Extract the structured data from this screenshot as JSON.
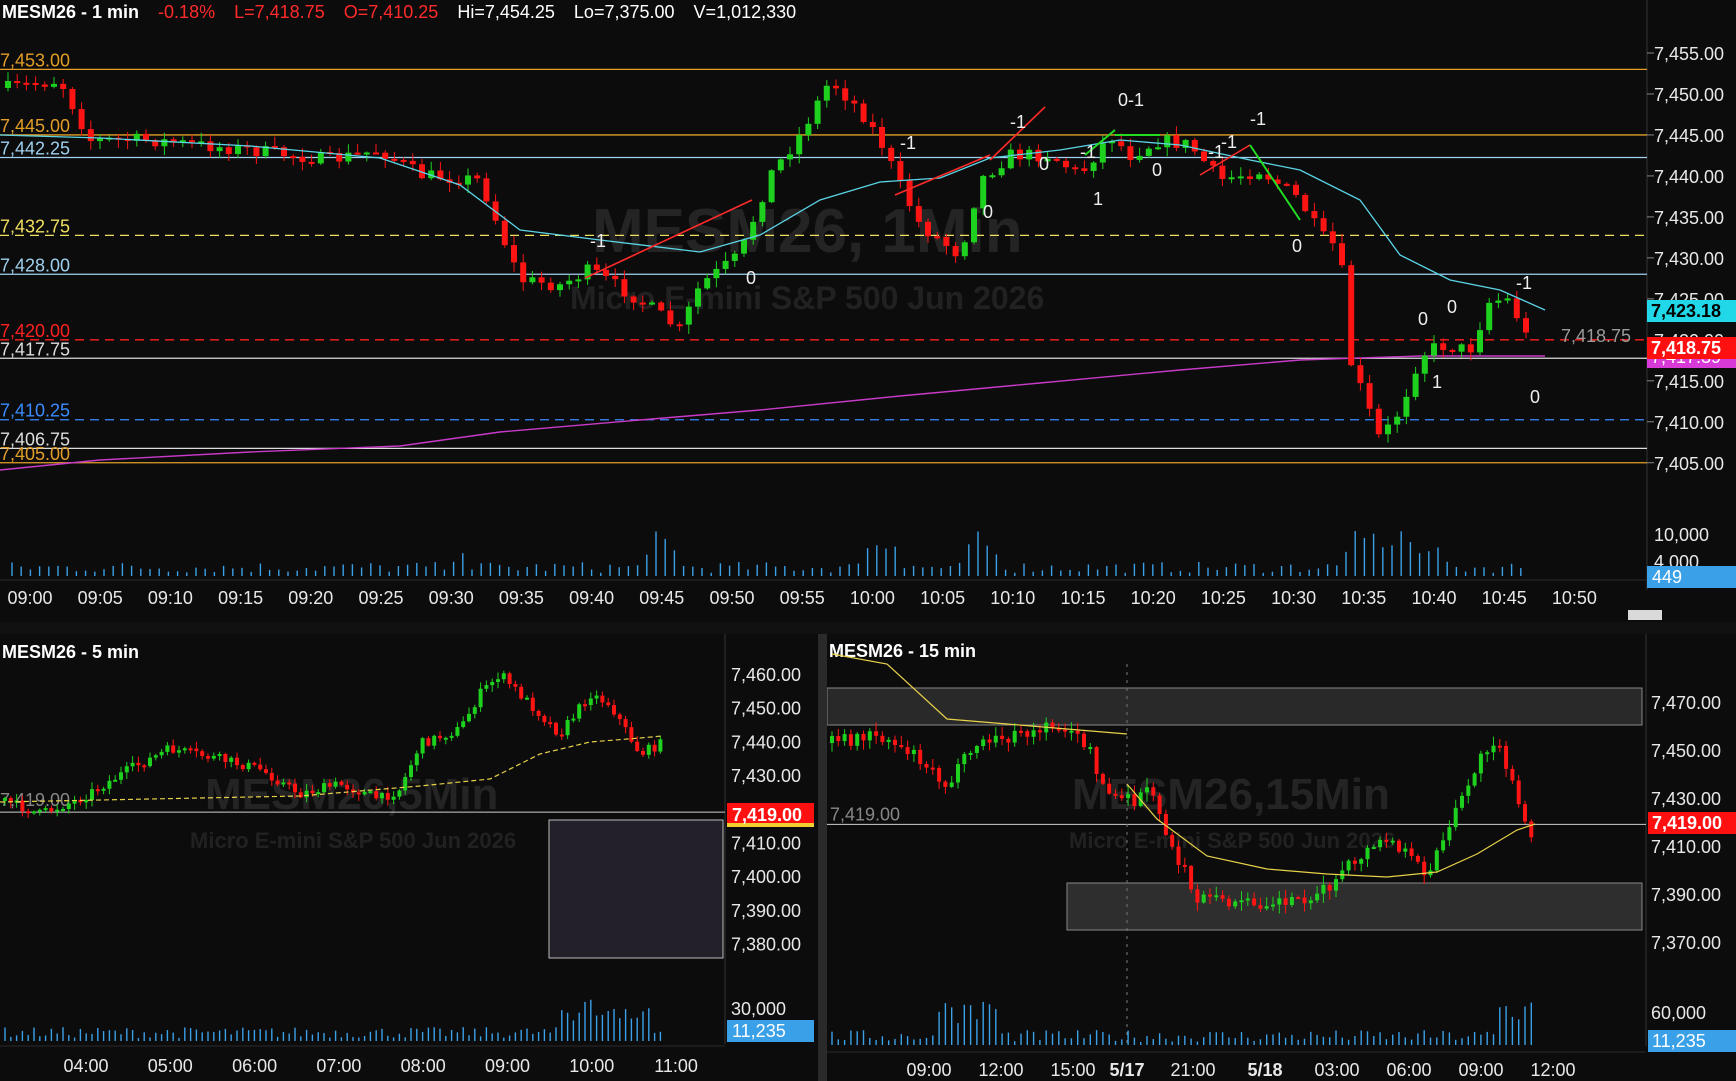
{
  "colors": {
    "up": "#1fd11f",
    "down": "#ff1414",
    "cyan": "#5bd5e6",
    "magenta": "#c83ac8",
    "orange": "#e39e28",
    "volume": "#3aa0e8",
    "trend_up": "#ff2a2a",
    "trend_dn": "#22dd22"
  },
  "main": {
    "header": {
      "symbol": "MESM26 - 1 min",
      "change": "-0.18%",
      "last": "L=7,418.75",
      "open": "O=7,410.25",
      "high": "Hi=7,454.25",
      "low": "Lo=7,375.00",
      "volume": "V=1,012,330"
    },
    "watermark": {
      "title": "MESM26, 1Min",
      "subtitle": "Micro E-mini S&P 500 Jun 2026"
    },
    "y_ticks": [
      "7,455.00",
      "7,450.00",
      "7,445.00",
      "7,440.00",
      "7,435.00",
      "7,430.00",
      "7,425.00",
      "7,420.00",
      "7,415.00",
      "7,410.00",
      "7,405.00"
    ],
    "x_ticks": [
      "09:00",
      "09:05",
      "09:10",
      "09:15",
      "09:20",
      "09:25",
      "09:30",
      "09:35",
      "09:40",
      "09:45",
      "09:50",
      "09:55",
      "10:00",
      "10:05",
      "10:10",
      "10:15",
      "10:20",
      "10:25",
      "10:30",
      "10:35",
      "10:40",
      "10:45",
      "10:50"
    ],
    "levels": [
      {
        "label": "7,453.00",
        "value": 7453.0,
        "color": "#e39e28",
        "style": "solid"
      },
      {
        "label": "7,445.00",
        "value": 7445.0,
        "color": "#e39e28",
        "style": "solid"
      },
      {
        "label": "7,442.25",
        "value": 7442.25,
        "color": "#9fd0ef",
        "style": "solid"
      },
      {
        "label": "7,432.75",
        "value": 7432.75,
        "color": "#f0e060",
        "style": "dashed"
      },
      {
        "label": "7,428.00",
        "value": 7428.0,
        "color": "#9fd0ef",
        "style": "solid"
      },
      {
        "label": "7,420.00",
        "value": 7420.0,
        "color": "#ff2020",
        "style": "dashed"
      },
      {
        "label": "7,417.75",
        "value": 7417.75,
        "color": "#dddddd",
        "style": "solid"
      },
      {
        "label": "7,410.25",
        "value": 7410.25,
        "color": "#3a8cff",
        "style": "dashed"
      },
      {
        "label": "7,406.75",
        "value": 7406.75,
        "color": "#dddddd",
        "style": "solid"
      },
      {
        "label": "7,405.00",
        "value": 7405.0,
        "color": "#e39e28",
        "style": "solid"
      }
    ],
    "badges": {
      "cyan": "7,423.18",
      "last": "7,418.75",
      "magenta": "7,417.39",
      "last_grey": "7,418.75",
      "vol_ticks": [
        "10,000",
        "4,000"
      ],
      "vol_current": "449"
    },
    "swing_labels": [
      {
        "t": "-1",
        "x": 590,
        "y": 247
      },
      {
        "t": "0",
        "x": 746,
        "y": 284
      },
      {
        "t": "-1",
        "x": 900,
        "y": 149
      },
      {
        "t": "0",
        "x": 983,
        "y": 218
      },
      {
        "t": "-1",
        "x": 1010,
        "y": 128
      },
      {
        "t": "0",
        "x": 1039,
        "y": 170
      },
      {
        "t": "-1",
        "x": 1080,
        "y": 158
      },
      {
        "t": "1",
        "x": 1093,
        "y": 205
      },
      {
        "t": "0-1",
        "x": 1118,
        "y": 106
      },
      {
        "t": "0",
        "x": 1152,
        "y": 176
      },
      {
        "t": "-1",
        "x": 1208,
        "y": 158
      },
      {
        "t": "-1",
        "x": 1221,
        "y": 148
      },
      {
        "t": "-1",
        "x": 1250,
        "y": 125
      },
      {
        "t": "0",
        "x": 1292,
        "y": 252
      },
      {
        "t": "0",
        "x": 1418,
        "y": 325
      },
      {
        "t": "0",
        "x": 1447,
        "y": 313
      },
      {
        "t": "1",
        "x": 1432,
        "y": 388
      },
      {
        "t": "-1",
        "x": 1516,
        "y": 289
      },
      {
        "t": "0",
        "x": 1530,
        "y": 403
      }
    ]
  },
  "bl": {
    "header": {
      "symbol": "MESM26 - 5 min"
    },
    "watermark": {
      "title": "MESM26,5Min",
      "subtitle": "Micro E-mini S&P 500 Jun 2026"
    },
    "y_ticks": [
      "7,460.00",
      "7,450.00",
      "7,440.00",
      "7,430.00",
      "7,420.00",
      "7,410.00",
      "7,400.00",
      "7,390.00",
      "7,380.00"
    ],
    "x_ticks": [
      "04:00",
      "05:00",
      "06:00",
      "07:00",
      "08:00",
      "09:00",
      "10:00",
      "11:00"
    ],
    "level": "7,419.00",
    "badge": "7,419.00",
    "vol_tick": "30,000",
    "vol_current": "11,235"
  },
  "br": {
    "header": {
      "symbol": "MESM26 - 15 min"
    },
    "watermark": {
      "title": "MESM26,15Min",
      "subtitle": "Micro E-mini S&P 500 Jun 2026"
    },
    "y_ticks": [
      "7,470.00",
      "7,450.00",
      "7,430.00",
      "7,410.00",
      "7,390.00",
      "7,370.00"
    ],
    "x_ticks": [
      "09:00",
      "12:00",
      "15:00",
      "5/17",
      "21:00",
      "5/18",
      "03:00",
      "06:00",
      "09:00",
      "12:00"
    ],
    "level": "7,419.00",
    "badge": "7,419.00",
    "vol_tick": "60,000",
    "vol_current": "11,235"
  }
}
